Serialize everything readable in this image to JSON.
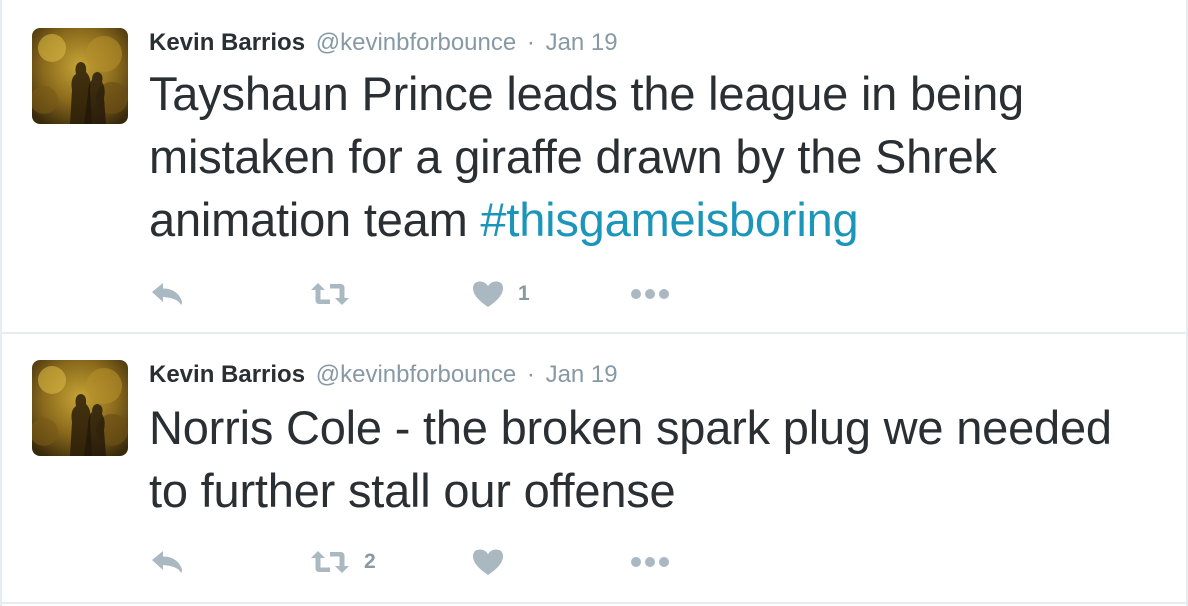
{
  "tweets": [
    {
      "fullname": "Kevin Barrios",
      "username": "@kevinbforbounce",
      "separator": "·",
      "date": "Jan 19",
      "text_main": "Tayshaun Prince leads the league in being mistaken for a giraffe drawn by the Shrek animation team ",
      "hashtag": "#thisgameisboring",
      "actions": {
        "reply_icon": "reply-icon",
        "retweet_icon": "retweet-icon",
        "retweet_count": "",
        "like_icon": "heart-icon",
        "like_count": "1",
        "more_icon": "more-icon"
      }
    },
    {
      "fullname": "Kevin Barrios",
      "username": "@kevinbforbounce",
      "separator": "·",
      "date": "Jan 19",
      "text_main": "Norris Cole - the broken spark plug we needed to further stall our offense",
      "hashtag": "",
      "actions": {
        "reply_icon": "reply-icon",
        "retweet_icon": "retweet-icon",
        "retweet_count": "2",
        "like_icon": "heart-icon",
        "like_count": "",
        "more_icon": "more-icon"
      }
    }
  ],
  "colors": {
    "icon_gray": "#aab8c2",
    "meta_gray": "#8899a6",
    "hashtag_blue": "#1b95b9",
    "text_dark": "#292f33",
    "divider": "#e6ecf0"
  }
}
